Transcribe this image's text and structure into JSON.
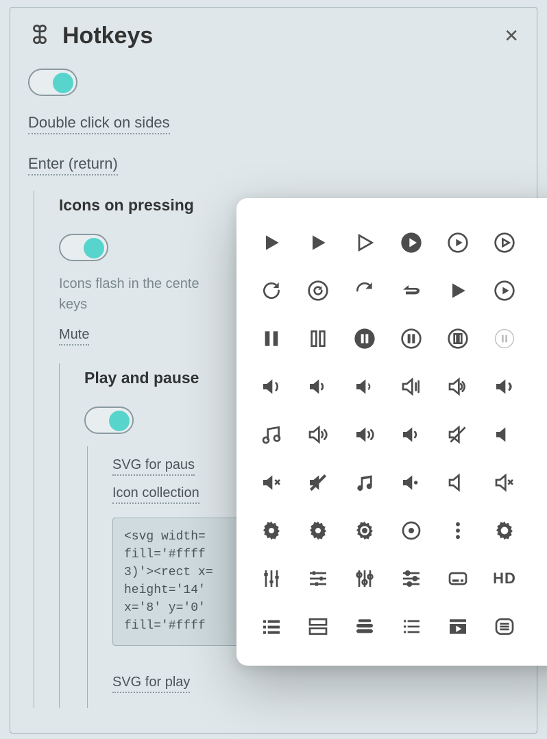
{
  "header": {
    "title": "Hotkeys"
  },
  "links": {
    "double_click_sides": "Double click on sides",
    "enter_return": "Enter (return)",
    "mute": "Mute",
    "svg_for_pause": "SVG for paus",
    "icon_collection": "Icon collection",
    "svg_for_play": "SVG for play"
  },
  "sections": {
    "icons_on_pressing": "Icons on pressing",
    "play_and_pause": "Play and pause"
  },
  "help": {
    "icons_flash": "Icons flash in the cente\nkeys"
  },
  "code": {
    "svg_snippet": "<svg width=\nfill='#ffff\n3)'><rect x=\nheight='14'\nx='8' y='0'\nfill='#ffff"
  },
  "popover": {
    "icons": [
      [
        "play-solid",
        "play-solid2",
        "play-outline",
        "play-circle-solid",
        "play-circle-outline",
        "play-circle-thin",
        "…"
      ],
      [
        "refresh-cw",
        "refresh-ccw-ring",
        "redo",
        "rewind-arrow",
        "play-solid3",
        "play-circle-outline2",
        "…"
      ],
      [
        "pause-solid",
        "pause-outline",
        "pause-circle-solid",
        "pause-circle-outline",
        "pause-circle-double",
        "pause-circle-thin",
        "…"
      ],
      [
        "volume-wave-solid",
        "volume-wave-solid2",
        "volume-half",
        "volume-outline",
        "volume-outline2",
        "volume-up-solid",
        "…"
      ],
      [
        "music-note",
        "volume-lines-outline",
        "volume-lines-solid",
        "volume-lines-solid2",
        "volume-slash",
        "speaker-solid",
        "…"
      ],
      [
        "speaker-x",
        "volume-slash-solid",
        "music-note-solid",
        "volume-half-solid",
        "speaker-outline",
        "speaker-x-outline",
        "…"
      ],
      [
        "gear-solid",
        "gear-solid2",
        "gear-ring",
        "gear-target",
        "more-vertical",
        "gear-outline",
        "…"
      ],
      [
        "sliders-vertical",
        "sliders-horizontal",
        "knobs",
        "sliders-horizontal2",
        "cc-badge",
        "hd",
        "…"
      ],
      [
        "list-bullets",
        "list-rows",
        "list-stack",
        "list-ordered",
        "video-thumb",
        "list-rounded",
        "…"
      ]
    ]
  }
}
